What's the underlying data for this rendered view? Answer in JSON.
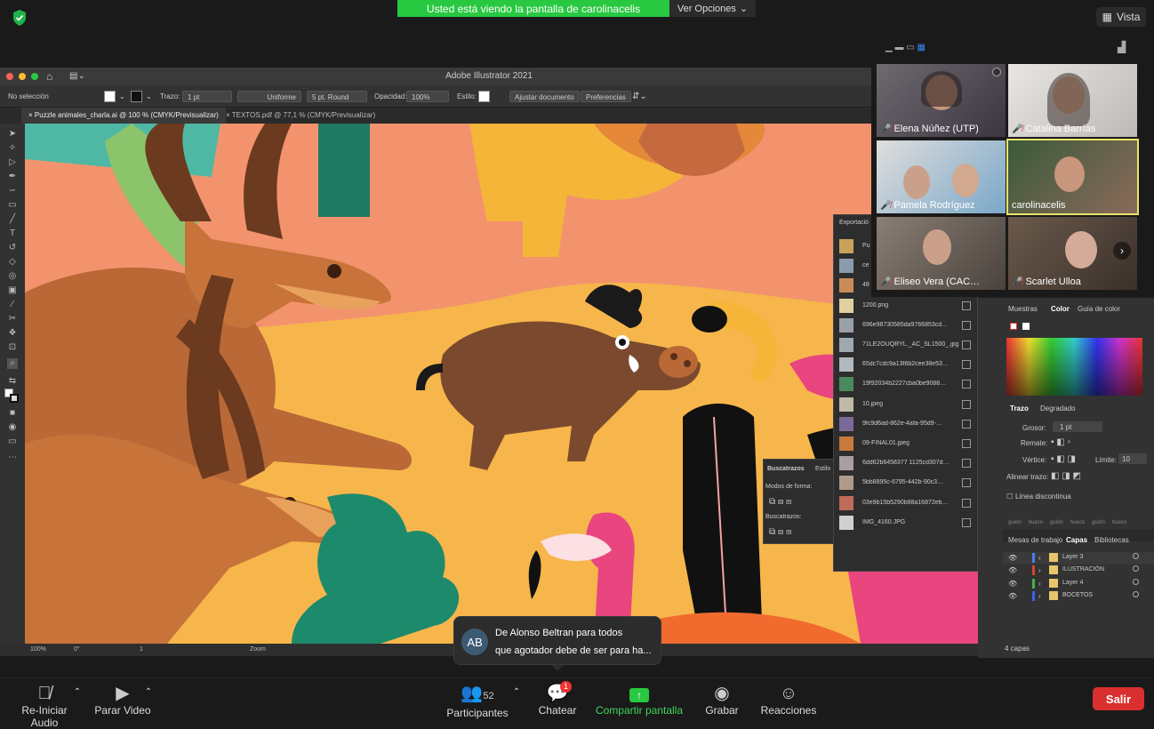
{
  "zoom_top": {
    "share_banner": "Usted está viendo la pantalla de carolinacelis",
    "view_options": "Ver Opciones",
    "view_button": "Vista"
  },
  "illustrator": {
    "window_title": "Adobe Illustrator 2021",
    "control_bar": {
      "selection": "No selección",
      "stroke_label": "Trazo:",
      "stroke_value": "1 pt",
      "stroke_profile": "Uniforme",
      "brush": "5 pt. Round",
      "opacity_label": "Opacidad:",
      "opacity_value": "100%",
      "style_label": "Estilo:",
      "adjust_document": "Ajustar documento",
      "preferences": "Preferencias"
    },
    "tabs": [
      {
        "label": "Puzzle animales_charla.ai @ 100 % (CMYK/Previsualizar)"
      },
      {
        "label": "TEXTOS.pdf @ 77,1 % (CMYK/Previsualizar)"
      }
    ],
    "status": {
      "zoom": "100%",
      "rotation": "0°",
      "artboard": "1",
      "tool": "Zoom"
    },
    "export_panel": {
      "title": "Exportació",
      "items": [
        "Pu",
        "ce",
        "48",
        "1200.png",
        "696e98730585da9766853cd…",
        "71LE2OUQRYL._AC_SL1500_.jpg",
        "65dc7cdc9a13f6b2cee38e53…",
        "19f92034b2227cba0be9088…",
        "10.jpeg",
        "9fc9d6ad-862e-4afa-95d9-…",
        "09-FINAL01.jpeg",
        "6dd62b6458377 1125cd307d…",
        "5bb8895c-6795-442b-90c3…",
        "03e9b15b5290b88a16872eb…",
        "IMG_4160.JPG"
      ]
    },
    "pathfinder": {
      "tab1": "Buscatrazos",
      "tab2": "Estilo",
      "shape_modes": "Modos de forma:",
      "pathfinders": "Buscatrazos:"
    },
    "color_panel": {
      "tabs": [
        "Muestras",
        "Color",
        "Guía de color"
      ]
    },
    "stroke_panel": {
      "tabs": [
        "Trazo",
        "Degradado"
      ],
      "weight_label": "Grosor:",
      "weight_value": "1 pt",
      "cap_label": "Remate:",
      "corner_label": "Vértice:",
      "limit_label": "Límite:",
      "limit_value": "10",
      "align_label": "Alinear trazo:",
      "dashed_label": "Línea discontinua",
      "dash_labels": [
        "guión",
        "hueco",
        "guión",
        "hueco",
        "guión",
        "hueco"
      ]
    },
    "layers_panel": {
      "tabs": [
        "Mesas de trabajo",
        "Capas",
        "Bibliotecas"
      ],
      "layers": [
        {
          "name": "Layer 3",
          "color": "#4a7cf0"
        },
        {
          "name": "ILUSTRACIÓN",
          "color": "#d8442e"
        },
        {
          "name": "Layer 4",
          "color": "#3fb24a"
        },
        {
          "name": "BOCETOS",
          "color": "#3a5ef0"
        }
      ],
      "count": "4 capas"
    }
  },
  "gallery": {
    "participants": [
      {
        "name": "Elena Núñez (UTP)"
      },
      {
        "name": "Catalina Barrías"
      },
      {
        "name": "Pamela Rodríguez"
      },
      {
        "name": "carolinacelis"
      },
      {
        "name": "Eliseo Vera (CAC…"
      },
      {
        "name": "Scarlet Ulloa"
      }
    ]
  },
  "chat_notification": {
    "initials": "AB",
    "line1": "De Alonso Beltran para todos",
    "line2": "que agotador debe de ser para ha..."
  },
  "zoom_bottom": {
    "audio": "Re-Iniciar Audio",
    "video": "Parar Video",
    "participants": "Participantes",
    "participants_count": "52",
    "chat": "Chatear",
    "chat_badge": "1",
    "share": "Compartir pantalla",
    "record": "Grabar",
    "reactions": "Reacciones",
    "leave": "Salir"
  },
  "colors": {
    "share_green": "#28c840",
    "leave_red": "#d9302f",
    "canvas_salmon": "#f3936d",
    "active_speaker": "#e9e36a"
  }
}
